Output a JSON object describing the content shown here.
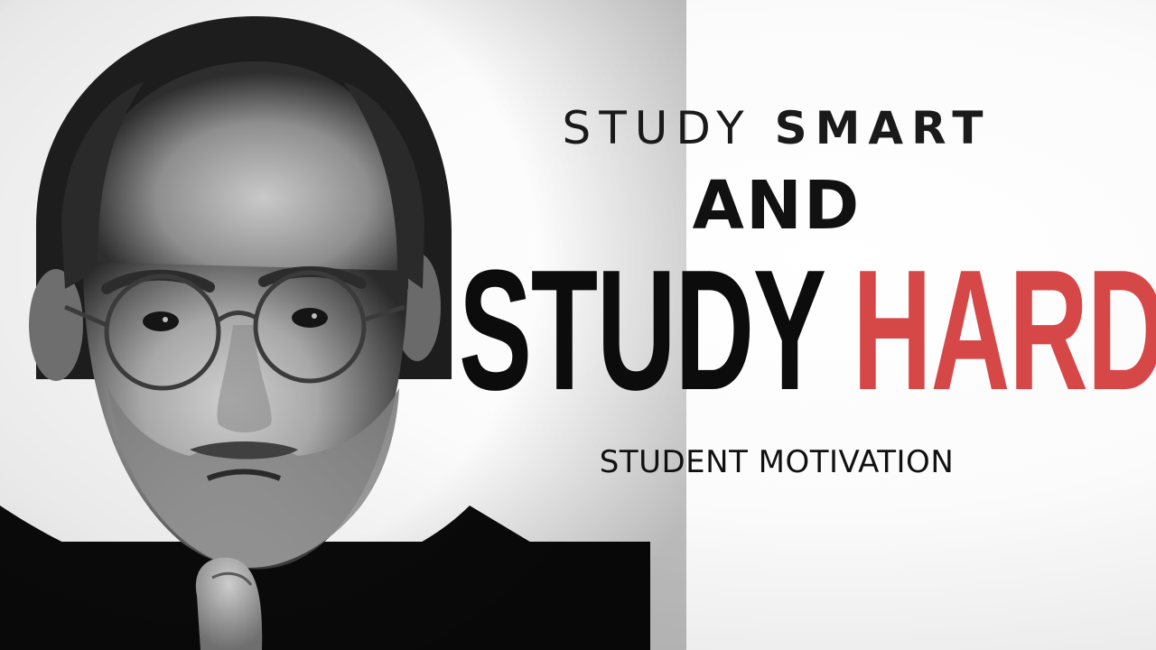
{
  "headline": {
    "line1_light": "STUDY",
    "line1_bold": "SMART",
    "line2": "AND",
    "line3_black": "STUDY",
    "line3_red": "HARD",
    "subtitle": "STUDENT MOTIVATION"
  },
  "colors": {
    "accent_red": "#d64848",
    "text_dark": "#111111",
    "background": "#ffffff"
  },
  "portrait": {
    "style": "black-and-white photograph",
    "subject": "man with round glasses, short gray beard, hand on chin, black turtleneck"
  }
}
